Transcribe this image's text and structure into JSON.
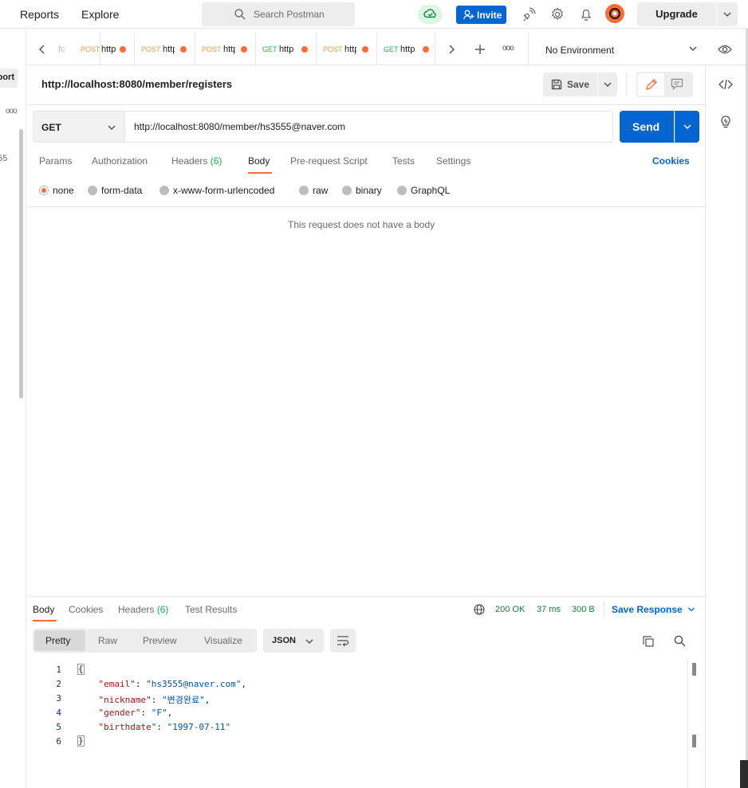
{
  "topbar": {
    "nav_reports": "Reports",
    "nav_explore": "Explore",
    "search_placeholder": "Search Postman",
    "invite_label": "Invite",
    "upgrade_label": "Upgrade"
  },
  "leftsidebar": {
    "import_label": "Import",
    "more_dots": "ooo",
    "fragment": "55"
  },
  "tabs": {
    "items": [
      {
        "method": "",
        "url": "fc"
      },
      {
        "method": "POST",
        "url": "http"
      },
      {
        "method": "POST",
        "url": "http"
      },
      {
        "method": "POST",
        "url": "http"
      },
      {
        "method": "GET",
        "url": "http"
      },
      {
        "method": "POST",
        "url": "http"
      },
      {
        "method": "GET",
        "url": "http"
      }
    ],
    "more_dots": "ooo",
    "environment": "No Environment"
  },
  "request": {
    "name": "http://localhost:8080/member/registers",
    "save_label": "Save",
    "method": "GET",
    "url": "http://localhost:8080/member/hs3555@naver.com",
    "send_label": "Send",
    "subtabs": {
      "params": "Params",
      "authorization": "Authorization",
      "headers": "Headers",
      "headers_count": "(6)",
      "body": "Body",
      "prerequest": "Pre-request Script",
      "tests": "Tests",
      "settings": "Settings"
    },
    "cookies_label": "Cookies",
    "body_types": [
      "none",
      "form-data",
      "x-www-form-urlencoded",
      "raw",
      "binary",
      "GraphQL"
    ],
    "selected_body_type": "none",
    "empty_body_message": "This request does not have a body"
  },
  "response": {
    "tabs": {
      "body": "Body",
      "cookies": "Cookies",
      "headers": "Headers",
      "headers_count": "(6)",
      "test_results": "Test Results"
    },
    "status": "200 OK",
    "time": "37 ms",
    "size": "300 B",
    "save_response_label": "Save Response",
    "view_modes": [
      "Pretty",
      "Raw",
      "Preview",
      "Visualize"
    ],
    "selected_view": "Pretty",
    "format": "JSON",
    "line_numbers": [
      "1",
      "2",
      "3",
      "4",
      "5",
      "6"
    ],
    "json_open": "{",
    "json_close": "}",
    "fields": [
      {
        "key": "\"email\"",
        "value": "\"hs3555@naver.com\"",
        "trail": ","
      },
      {
        "key": "\"nickname\"",
        "value": "\"변경완료\"",
        "trail": ","
      },
      {
        "key": "\"gender\"",
        "value": "\"F\"",
        "trail": ","
      },
      {
        "key": "\"birthdate\"",
        "value": "\"1997-07-11\"",
        "trail": ""
      }
    ]
  },
  "colors": {
    "accent": "#ff6c37",
    "primary": "#0265d2",
    "get_method": "#0cbb52",
    "post_method": "#e79c3c"
  }
}
